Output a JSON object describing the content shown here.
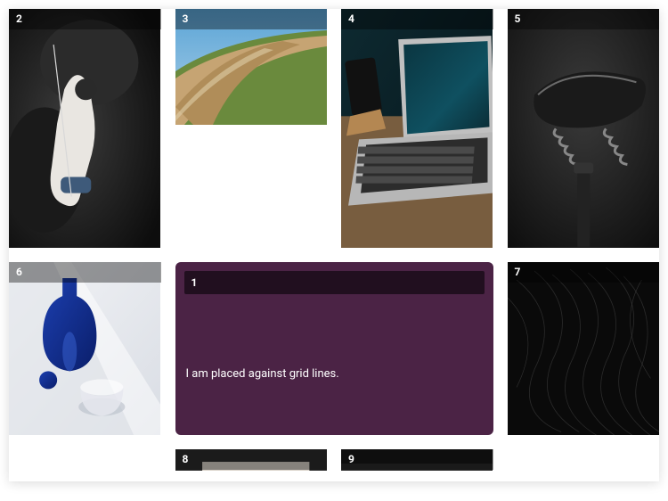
{
  "tiles": {
    "t2": {
      "label": "2",
      "alt": "rock-climber"
    },
    "t3": {
      "label": "3",
      "alt": "dirt-road-hill"
    },
    "t4": {
      "label": "4",
      "alt": "laptop-phone-desk"
    },
    "t5": {
      "label": "5",
      "alt": "bicycle-saddle"
    },
    "t6": {
      "label": "6",
      "alt": "blue-glass-bottle"
    },
    "t7": {
      "label": "7",
      "alt": "dark-wires-abstract"
    },
    "t8": {
      "label": "8",
      "alt": "photo"
    },
    "t9": {
      "label": "9",
      "alt": "photo"
    }
  },
  "featured": {
    "label": "1",
    "body": "I am placed against grid lines.",
    "background": "#4b2345"
  }
}
